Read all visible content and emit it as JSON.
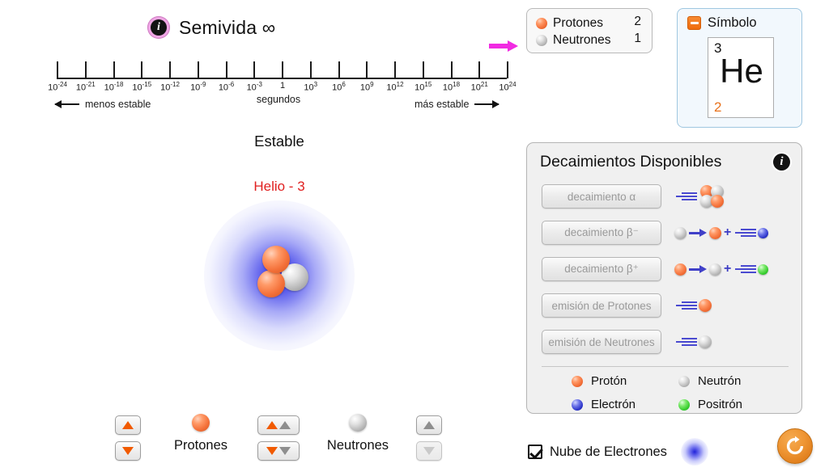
{
  "halflife": {
    "info_icon": "info-icon",
    "title": "Semivida ∞",
    "units": "segundos",
    "less_stable": "menos estable",
    "more_stable": "más estable",
    "pointer_color": "#f12ae2",
    "ticks": [
      {
        "base": "10",
        "exp": "-24"
      },
      {
        "base": "10",
        "exp": "-21"
      },
      {
        "base": "10",
        "exp": "-18"
      },
      {
        "base": "10",
        "exp": "-15"
      },
      {
        "base": "10",
        "exp": "-12"
      },
      {
        "base": "10",
        "exp": "-9"
      },
      {
        "base": "10",
        "exp": "-6"
      },
      {
        "base": "10",
        "exp": "-3"
      },
      {
        "base": "1",
        "exp": ""
      },
      {
        "base": "10",
        "exp": "3"
      },
      {
        "base": "10",
        "exp": "6"
      },
      {
        "base": "10",
        "exp": "9"
      },
      {
        "base": "10",
        "exp": "12"
      },
      {
        "base": "10",
        "exp": "15"
      },
      {
        "base": "10",
        "exp": "18"
      },
      {
        "base": "10",
        "exp": "21"
      },
      {
        "base": "10",
        "exp": "24"
      }
    ]
  },
  "nucleus": {
    "stability": "Estable",
    "isotope_name": "Helio - 3",
    "isotope_color": "#e02020",
    "protons_shown": 2,
    "neutrons_shown": 1
  },
  "particle_count": {
    "rows": [
      {
        "icon": "proton-icon",
        "label": "Protones",
        "value": "2"
      },
      {
        "icon": "neutron-icon",
        "label": "Neutrones",
        "value": "1"
      }
    ]
  },
  "symbol_panel": {
    "collapse_icon": "minus-box-icon",
    "title": "Símbolo",
    "mass_number": "3",
    "element_symbol": "He",
    "atomic_number": "2",
    "atomic_number_color": "#e8721c"
  },
  "decay_panel": {
    "title": "Decaimientos Disponibles",
    "info_icon": "info-icon",
    "rows": [
      {
        "label": "decaimiento α",
        "enabled": false,
        "icon": "alpha-decay-icon"
      },
      {
        "label": "decaimiento β⁻",
        "enabled": false,
        "icon": "beta-minus-decay-icon"
      },
      {
        "label": "decaimiento β⁺",
        "enabled": false,
        "icon": "beta-plus-decay-icon"
      },
      {
        "label": "emisión de Protones",
        "enabled": false,
        "icon": "proton-emission-icon"
      },
      {
        "label": "emisión de Neutrones",
        "enabled": false,
        "icon": "neutron-emission-icon"
      }
    ],
    "legend": [
      {
        "label": "Protón",
        "color": "#f4713a",
        "icon": "proton-icon"
      },
      {
        "label": "Neutrón",
        "color": "#b9b9b9",
        "icon": "neutron-icon"
      },
      {
        "label": "Electrón",
        "color": "#2a32c8",
        "icon": "electron-icon"
      },
      {
        "label": "Positrón",
        "color": "#35cc2c",
        "icon": "positron-icon"
      }
    ]
  },
  "nucleon_controls": {
    "protons_label": "Protones",
    "neutrons_label": "Neutrones",
    "proton_color": "#f15a00",
    "neutron_color": "#8e8e8e",
    "proton_up_enabled": true,
    "proton_down_enabled": true,
    "both_up_enabled": true,
    "both_down_enabled": true,
    "neutron_up_enabled": true,
    "neutron_down_enabled": false
  },
  "electron_cloud": {
    "label": "Nube de Electrones",
    "checked": true,
    "swatch_color": "#1616dc"
  },
  "reset": {
    "icon": "reset-refresh-icon",
    "color": "#ef9634"
  }
}
